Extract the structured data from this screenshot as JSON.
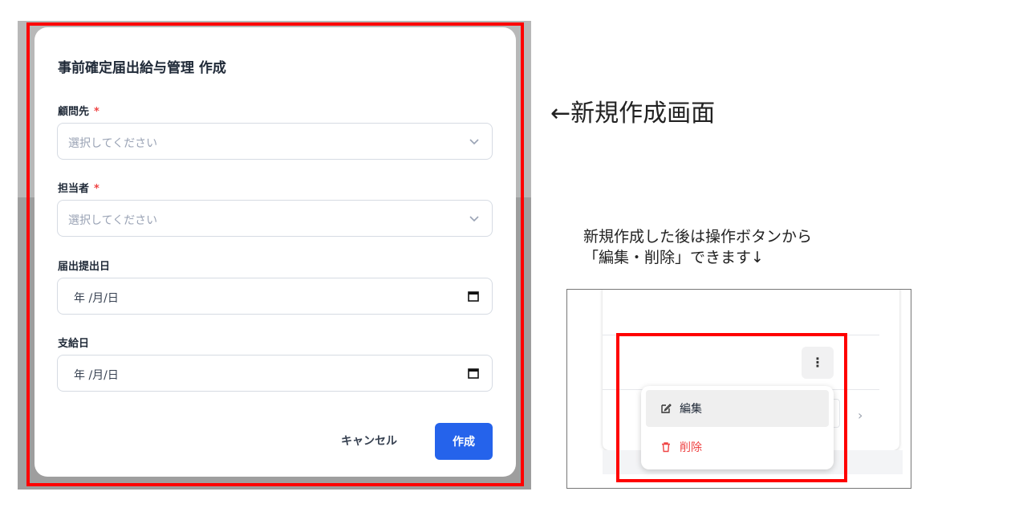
{
  "dialog": {
    "title": "事前確定届出給与管理 作成",
    "required_mark": "*",
    "fields": [
      {
        "label": "顧問先",
        "required": true,
        "type": "select",
        "placeholder": "選択してください"
      },
      {
        "label": "担当者",
        "required": true,
        "type": "select",
        "placeholder": "選択してください"
      },
      {
        "label": "届出提出日",
        "required": false,
        "type": "date",
        "value": "年 /月/日"
      },
      {
        "label": "支給日",
        "required": false,
        "type": "date",
        "value": "年 /月/日"
      }
    ],
    "cancel_label": "キャンセル",
    "create_label": "作成"
  },
  "annotations": {
    "new_screen": "←新規作成画面",
    "note_line1": "新規作成した後は操作ボタンから",
    "note_line2": "「編集・削除」できます↓"
  },
  "action_menu": {
    "kebab_glyph": "⋮",
    "edit_label": "編集",
    "delete_label": "削除",
    "chevron_glyph": "›"
  },
  "colors": {
    "primary": "#2563eb",
    "danger": "#ef4444",
    "highlight_frame": "#ff0000"
  }
}
